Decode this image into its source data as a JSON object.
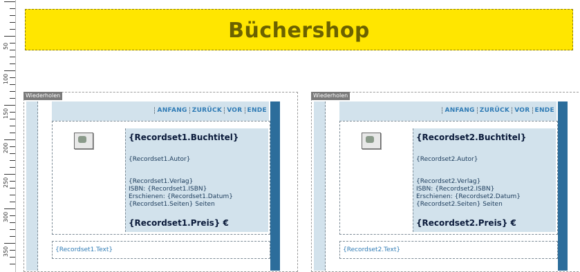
{
  "header": {
    "title": "Büchershop"
  },
  "panels": [
    {
      "tag": "Wiederholen",
      "nav": [
        "ANFANG",
        "ZURÜCK",
        "VOR",
        "ENDE"
      ],
      "buchtitel": "{Recordset1.Buchtitel}",
      "autor": "{Recordset1.Autor}",
      "verlag": "{Recordset1.Verlag}",
      "isbn": "ISBN: {Recordset1.ISBN}",
      "erschienen": "Erschienen: {Recordset1.Datum}",
      "seiten": "{Recordset1.Seiten} Seiten",
      "preis": "{Recordset1.Preis} €",
      "text": "{Recordset1.Text}"
    },
    {
      "tag": "Wiederholen",
      "nav": [
        "ANFANG",
        "ZURÜCK",
        "VOR",
        "ENDE"
      ],
      "buchtitel": "{Recordset2.Buchtitel}",
      "autor": "{Recordset2.Autor}",
      "verlag": "{Recordset2.Verlag}",
      "isbn": "ISBN: {Recordset2.ISBN}",
      "erschienen": "Erschienen: {Recordset2.Datum}",
      "seiten": "{Recordset2.Seiten} Seiten",
      "preis": "{Recordset2.Preis} €",
      "text": "{Recordset2.Text}"
    }
  ],
  "ruler": {
    "labels": [
      "50",
      "100",
      "150",
      "200",
      "250",
      "300",
      "350"
    ]
  }
}
